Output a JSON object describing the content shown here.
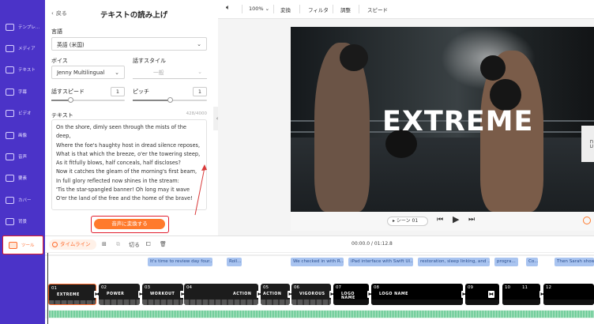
{
  "sidebar": {
    "items": [
      {
        "label": "テンプレ...",
        "icon": "template-icon"
      },
      {
        "label": "メディア",
        "icon": "folder-icon"
      },
      {
        "label": "テキスト",
        "icon": "text-icon"
      },
      {
        "label": "字幕",
        "icon": "subtitle-icon"
      },
      {
        "label": "ビデオ",
        "icon": "video-icon"
      },
      {
        "label": "画像",
        "icon": "image-icon"
      },
      {
        "label": "音声",
        "icon": "music-icon"
      },
      {
        "label": "要素",
        "icon": "shapes-icon"
      },
      {
        "label": "カバー",
        "icon": "cover-icon"
      },
      {
        "label": "背景",
        "icon": "background-icon"
      },
      {
        "label": "ツール",
        "icon": "toolbox-icon"
      }
    ]
  },
  "panel": {
    "back_label": "戻る",
    "title": "テキストの読み上げ",
    "language_label": "言語",
    "language_value": "英語 (米国)",
    "voice_label": "ボイス",
    "voice_value": "Jenny Multilingual",
    "style_label": "話すスタイル",
    "style_value": "一般",
    "speed_label": "話すスピード",
    "speed_value": "1",
    "speed_fill": 0.26,
    "pitch_label": "ピッチ",
    "pitch_value": "1",
    "pitch_fill": 0.5,
    "text_label": "テキスト",
    "char_count": "428/4000",
    "text_lines": [
      "On the shore, dimly seen through the mists of the deep,",
      "Where the foe's haughty host in dread silence reposes,",
      "What is that which the breeze, o'er the towering steep,",
      "As it fitfully blows, half conceals, half discloses?",
      "Now it catches the gleam of the morning's first beam,",
      "In full glory reflected now shines in the stream:",
      "'Tis the star-spangled banner!  Oh long may it wave",
      "O'er the land of the free and the home of the brave!"
    ],
    "convert_button": "音声に変換する"
  },
  "toolbar": {
    "zoom": "100%",
    "convert": "変換",
    "filter": "フィルタ",
    "adjust": "調整",
    "speed": "スピード"
  },
  "preview": {
    "headline": "EXTREME",
    "scene_label": "シーン 01"
  },
  "timeline": {
    "tab_label": "タイムライン",
    "split_label": "切る",
    "time": "00:00.0 / 01:12.8",
    "subtitle_chips": [
      "It's time to review day four...",
      "Roll...",
      "We checked in with R...",
      "iPad interface with Swift UI...",
      "restoration, sleep linking, and ...",
      "progra...",
      "Co...",
      "Then Sarah show..."
    ],
    "clips": [
      {
        "num": "01",
        "caption": "EXTREME"
      },
      {
        "num": "02",
        "caption": "POWER"
      },
      {
        "num": "03",
        "caption": "WORKOUT"
      },
      {
        "num": "04",
        "caption": "ACTION"
      },
      {
        "num": "05",
        "caption": "ACTION"
      },
      {
        "num": "06",
        "caption": "VIGOROUS"
      },
      {
        "num": "07",
        "caption": "LOGO NAME"
      },
      {
        "num": "08",
        "caption": "LOGO NAME"
      },
      {
        "num": "09",
        "caption": ""
      },
      {
        "num": "10",
        "caption": ""
      },
      {
        "num": "11",
        "caption": ""
      },
      {
        "num": "12",
        "caption": ""
      }
    ]
  },
  "colors": {
    "sidebar": "#4b33c8",
    "accent": "#ff7a2c",
    "highlight": "#e21e2e",
    "subtitle_chip": "#a9c4f0",
    "audio_wave": "#58c489"
  }
}
